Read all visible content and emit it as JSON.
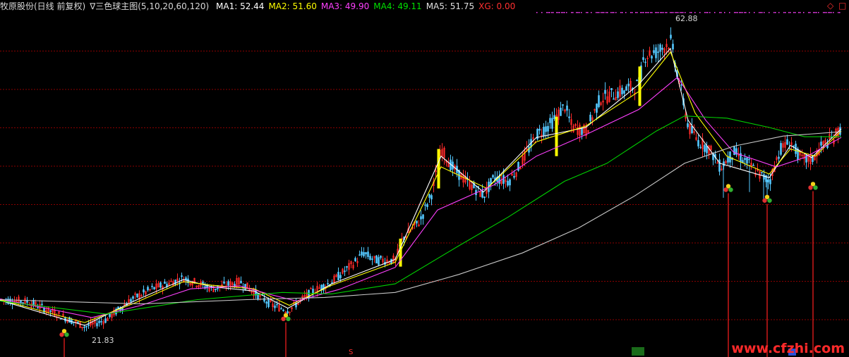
{
  "header": {
    "stock_name": "牧原股份(日线 前复权)",
    "indicator_name": "∇三色球主图(5,10,20,60,120)",
    "ma_readouts": [
      {
        "label": "MA1: 52.44",
        "color": "#ffffff"
      },
      {
        "label": "MA2: 51.60",
        "color": "#ffff00"
      },
      {
        "label": "MA3: 49.90",
        "color": "#ff40ff"
      },
      {
        "label": "MA4: 49.11",
        "color": "#00e000"
      },
      {
        "label": "MA5: 51.75",
        "color": "#e0e0e0"
      },
      {
        "label": "XG: 0.00",
        "color": "#ff3030"
      }
    ],
    "corner_icons": [
      "diamond-icon",
      "square-icon"
    ]
  },
  "watermark": "www.cfzhi.com",
  "colors": {
    "background": "#000000",
    "grid": "#8a0000",
    "up": "#ff2a2a",
    "down": "#54c8ff",
    "ma1": "#ffffff",
    "ma2": "#ffff00",
    "ma3": "#ff40ff",
    "ma4": "#00d000",
    "ma5": "#c8c8c8",
    "signal": "#ff2020"
  },
  "chart_data": {
    "type": "candlestick",
    "ylim": [
      18,
      66
    ],
    "max_label": "62.88",
    "min_label": "21.83",
    "price_path": [
      [
        0,
        26.0
      ],
      [
        40,
        25.7
      ],
      [
        85,
        23.8
      ],
      [
        120,
        22.2
      ],
      [
        150,
        23.2
      ],
      [
        185,
        26.0
      ],
      [
        215,
        27.5
      ],
      [
        260,
        29.0
      ],
      [
        300,
        27.5
      ],
      [
        340,
        28.5
      ],
      [
        360,
        27.0
      ],
      [
        385,
        25.2
      ],
      [
        408,
        24.5
      ],
      [
        440,
        27.0
      ],
      [
        470,
        28.5
      ],
      [
        500,
        31.0
      ],
      [
        515,
        32.5
      ],
      [
        530,
        31.5
      ],
      [
        560,
        31.5
      ],
      [
        570,
        34.5
      ],
      [
        595,
        37.0
      ],
      [
        612,
        41.0
      ],
      [
        625,
        47.0
      ],
      [
        640,
        44.5
      ],
      [
        660,
        42.5
      ],
      [
        685,
        40.5
      ],
      [
        700,
        43.0
      ],
      [
        720,
        42.5
      ],
      [
        735,
        44.5
      ],
      [
        760,
        49.0
      ],
      [
        780,
        50.5
      ],
      [
        800,
        53.0
      ],
      [
        810,
        50.0
      ],
      [
        830,
        49.5
      ],
      [
        850,
        54.0
      ],
      [
        880,
        55.0
      ],
      [
        905,
        56.0
      ],
      [
        912,
        60.0
      ],
      [
        930,
        60.5
      ],
      [
        950,
        62.0
      ],
      [
        965,
        55.0
      ],
      [
        975,
        50.0
      ],
      [
        990,
        48.0
      ],
      [
        1005,
        47.0
      ],
      [
        1020,
        44.5
      ],
      [
        1040,
        46.5
      ],
      [
        1060,
        45.0
      ],
      [
        1075,
        43.5
      ],
      [
        1090,
        42.5
      ],
      [
        1105,
        47.0
      ],
      [
        1120,
        48.0
      ],
      [
        1135,
        45.5
      ],
      [
        1150,
        45.5
      ],
      [
        1165,
        47.5
      ],
      [
        1180,
        48.5
      ],
      [
        1192,
        50.0
      ]
    ],
    "ma_lines": [
      {
        "name": "MA1",
        "color_key": "ma1",
        "points": [
          [
            0,
            25.9
          ],
          [
            120,
            22.4
          ],
          [
            190,
            25.8
          ],
          [
            260,
            28.8
          ],
          [
            300,
            27.8
          ],
          [
            360,
            27.2
          ],
          [
            408,
            24.8
          ],
          [
            470,
            28.2
          ],
          [
            560,
            31.6
          ],
          [
            625,
            46.0
          ],
          [
            685,
            41.0
          ],
          [
            760,
            48.6
          ],
          [
            830,
            50.0
          ],
          [
            905,
            56.0
          ],
          [
            950,
            61.0
          ],
          [
            975,
            51.0
          ],
          [
            1020,
            45.0
          ],
          [
            1090,
            43.0
          ],
          [
            1120,
            47.5
          ],
          [
            1150,
            45.8
          ],
          [
            1192,
            49.8
          ]
        ]
      },
      {
        "name": "MA2",
        "color_key": "ma2",
        "points": [
          [
            0,
            26.0
          ],
          [
            120,
            22.8
          ],
          [
            190,
            25.5
          ],
          [
            260,
            28.5
          ],
          [
            300,
            28.0
          ],
          [
            360,
            27.5
          ],
          [
            410,
            25.2
          ],
          [
            470,
            28.0
          ],
          [
            560,
            31.2
          ],
          [
            625,
            44.5
          ],
          [
            690,
            41.5
          ],
          [
            760,
            48.0
          ],
          [
            830,
            50.2
          ],
          [
            905,
            55.0
          ],
          [
            950,
            60.5
          ],
          [
            985,
            52.0
          ],
          [
            1030,
            46.0
          ],
          [
            1090,
            43.5
          ],
          [
            1120,
            47.0
          ],
          [
            1155,
            46.0
          ],
          [
            1192,
            49.5
          ]
        ]
      },
      {
        "name": "MA3",
        "color_key": "ma3",
        "points": [
          [
            0,
            26.1
          ],
          [
            130,
            23.5
          ],
          [
            200,
            25.2
          ],
          [
            270,
            27.5
          ],
          [
            340,
            27.9
          ],
          [
            380,
            26.8
          ],
          [
            420,
            25.8
          ],
          [
            480,
            27.4
          ],
          [
            560,
            30.5
          ],
          [
            620,
            38.5
          ],
          [
            700,
            42.0
          ],
          [
            760,
            46.0
          ],
          [
            830,
            49.0
          ],
          [
            905,
            52.5
          ],
          [
            960,
            57.0
          ],
          [
            1000,
            51.0
          ],
          [
            1040,
            46.5
          ],
          [
            1100,
            44.5
          ],
          [
            1140,
            45.8
          ],
          [
            1192,
            48.6
          ]
        ]
      },
      {
        "name": "MA4",
        "color_key": "ma4",
        "points": [
          [
            0,
            25.8
          ],
          [
            150,
            24.0
          ],
          [
            280,
            26.0
          ],
          [
            400,
            27.0
          ],
          [
            470,
            26.8
          ],
          [
            560,
            28.2
          ],
          [
            650,
            33.5
          ],
          [
            720,
            37.5
          ],
          [
            800,
            42.5
          ],
          [
            860,
            45.0
          ],
          [
            930,
            49.5
          ],
          [
            970,
            51.6
          ],
          [
            1030,
            51.3
          ],
          [
            1090,
            50.0
          ],
          [
            1140,
            48.7
          ],
          [
            1192,
            48.7
          ]
        ]
      },
      {
        "name": "MA5",
        "color_key": "ma5",
        "points": [
          [
            0,
            26.0
          ],
          [
            200,
            25.4
          ],
          [
            350,
            26.0
          ],
          [
            460,
            26.3
          ],
          [
            560,
            27.0
          ],
          [
            650,
            29.5
          ],
          [
            740,
            32.5
          ],
          [
            820,
            36.0
          ],
          [
            900,
            40.5
          ],
          [
            970,
            45.0
          ],
          [
            1040,
            47.4
          ],
          [
            1110,
            48.8
          ],
          [
            1192,
            49.4
          ]
        ]
      }
    ],
    "thick_volume_marks": [
      {
        "x": 567,
        "low": 30.6,
        "high": 34.5
      },
      {
        "x": 621,
        "low": 41.5,
        "high": 47.0
      },
      {
        "x": 788,
        "low": 46.0,
        "high": 51.5
      },
      {
        "x": 906,
        "low": 53.0,
        "high": 58.5
      }
    ],
    "ball_signals": [
      {
        "x": 91,
        "price": 21.8
      },
      {
        "x": 405,
        "price": 24.0
      },
      {
        "x": 1032,
        "price": 42.0
      },
      {
        "x": 1087,
        "price": 40.5
      },
      {
        "x": 1152,
        "price": 42.3
      }
    ],
    "top_dots": {
      "from": 760,
      "to": 1192
    }
  }
}
